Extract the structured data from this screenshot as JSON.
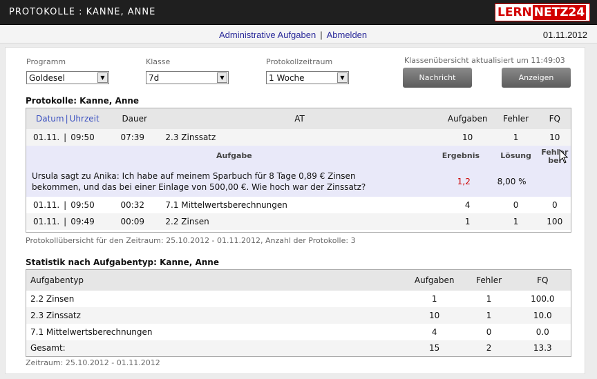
{
  "header": {
    "title": "PROTOKOLLE : KANNE, ANNE",
    "logo_part1": "LERN",
    "logo_part2": "NETZ24"
  },
  "nav": {
    "admin_link": "Administrative Aufgaben",
    "separator": "|",
    "logout_link": "Abmelden",
    "date": "01.11.2012"
  },
  "filters": {
    "program_label": "Programm",
    "program_value": "Goldesel",
    "class_label": "Klasse",
    "class_value": "7d",
    "period_label": "Protokollzeitraum",
    "period_value": "1 Woche",
    "updated_text": "Klassenübersicht aktualisiert um 11:49:03",
    "message_button": "Nachricht",
    "show_button": "Anzeigen"
  },
  "protocols": {
    "title": "Protokolle: Kanne, Anne",
    "columns": {
      "datum": "Datum",
      "sep": "|",
      "uhrzeit": "Uhrzeit",
      "dauer": "Dauer",
      "at": "AT",
      "aufgaben": "Aufgaben",
      "fehler": "Fehler",
      "fq": "FQ"
    },
    "rows": [
      {
        "date": "01.11.",
        "sep": "|",
        "time": "09:50",
        "dauer": "07:39",
        "at": "2.3 Zinssatz",
        "aufgaben": "10",
        "fehler": "1",
        "fq": "10"
      },
      {
        "date": "01.11.",
        "sep": "|",
        "time": "09:50",
        "dauer": "00:32",
        "at": "7.1 Mittelwertsberechnungen",
        "aufgaben": "4",
        "fehler": "0",
        "fq": "0"
      },
      {
        "date": "01.11.",
        "sep": "|",
        "time": "09:49",
        "dauer": "00:09",
        "at": "2.2 Zinsen",
        "aufgaben": "1",
        "fehler": "1",
        "fq": "100"
      }
    ],
    "detail": {
      "col_aufgabe": "Aufgabe",
      "col_ergebnis": "Ergebnis",
      "col_loesung": "Lösung",
      "col_fehler_1": "Fehler",
      "col_fehler_2": "bei",
      "task_line1": "Ursula sagt zu Anika: Ich habe auf meinem Sparbuch für 8 Tage 0,89 € Zinsen",
      "task_line2": "bekommen, und das bei einer Einlage von 500,00 €. Wie hoch war der Zinssatz?",
      "ergebnis": "1,2",
      "loesung": "8,00 %",
      "error_color": "#cc0000"
    },
    "summary": "Protokollübersicht für den Zeitraum: 25.10.2012 - 01.11.2012, Anzahl der Protokolle: 3"
  },
  "stats": {
    "title": "Statistik nach Aufgabentyp: Kanne, Anne",
    "columns": {
      "typ": "Aufgabentyp",
      "aufgaben": "Aufgaben",
      "fehler": "Fehler",
      "fq": "FQ"
    },
    "rows": [
      {
        "typ": "2.2 Zinsen",
        "aufgaben": "1",
        "fehler": "1",
        "fq": "100.0"
      },
      {
        "typ": "2.3 Zinssatz",
        "aufgaben": "10",
        "fehler": "1",
        "fq": "10.0"
      },
      {
        "typ": "7.1 Mittelwertsberechnungen",
        "aufgaben": "4",
        "fehler": "0",
        "fq": "0.0"
      },
      {
        "typ": "Gesamt:",
        "aufgaben": "15",
        "fehler": "2",
        "fq": "13.3"
      }
    ],
    "footer": "Zeitraum: 25.10.2012 - 01.11.2012"
  }
}
